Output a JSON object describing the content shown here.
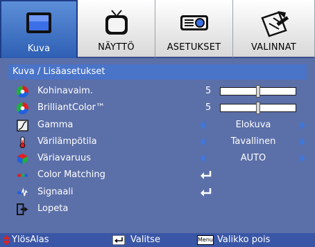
{
  "tabs": [
    {
      "label": "Kuva",
      "icon": "monitor-icon",
      "selected": true
    },
    {
      "label": "NÄYTTÖ",
      "icon": "tv-icon",
      "selected": false
    },
    {
      "label": "ASETUKSET",
      "icon": "projector-icon",
      "selected": false
    },
    {
      "label": "VALINNAT",
      "icon": "tools-icon",
      "selected": false
    }
  ],
  "breadcrumb": "Kuva / Lisäasetukset",
  "rows": [
    {
      "label": "Kohinavaim.",
      "value": "5",
      "level": 0.5,
      "icon": "rgb-circle-icon"
    },
    {
      "label": "BrilliantColor™",
      "value": "5",
      "level": 0.5,
      "icon": "rgb-circle-icon"
    },
    {
      "label": "Gamma",
      "option": "Elokuva",
      "icon": "gamma-icon"
    },
    {
      "label": "Värilämpötila",
      "option": "Tavallinen",
      "icon": "thermometer-icon"
    },
    {
      "label": "Väriavaruus",
      "option": "AUTO",
      "icon": "color-cube-icon"
    },
    {
      "label": "Color Matching",
      "icon": "color-matching-icon"
    },
    {
      "label": "Signaali",
      "icon": "signal-icon"
    },
    {
      "label": "Lopeta",
      "icon": "exit-icon"
    }
  ],
  "footer": {
    "nav_label": "YlösAlas",
    "select_label": "Valitse",
    "menu_key": "Menu",
    "exit_label": "Valikko pois"
  },
  "colors": {
    "selected_tab": "#3b6fc6",
    "background": "#5b6fa8",
    "arrow": "#3b78e0"
  }
}
